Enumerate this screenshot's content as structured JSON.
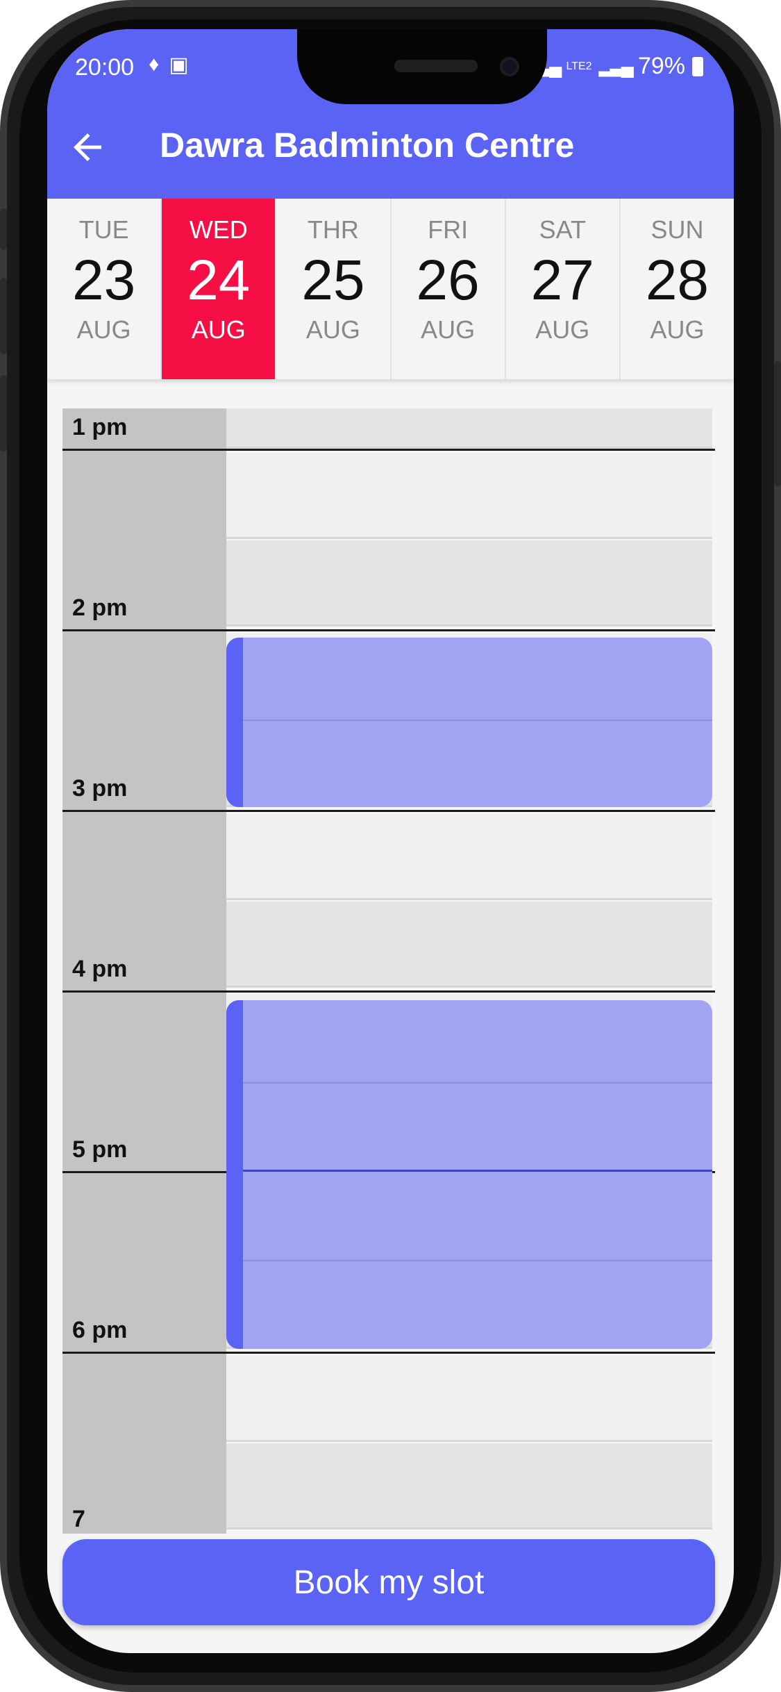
{
  "status_bar": {
    "time": "20:00",
    "battery": "79%",
    "network": "LTE2"
  },
  "header": {
    "title": "Dawra Badminton Centre"
  },
  "days": [
    {
      "name": "TUE",
      "num": "23",
      "month": "AUG",
      "selected": false
    },
    {
      "name": "WED",
      "num": "24",
      "month": "AUG",
      "selected": true
    },
    {
      "name": "THR",
      "num": "25",
      "month": "AUG",
      "selected": false
    },
    {
      "name": "FRI",
      "num": "26",
      "month": "AUG",
      "selected": false
    },
    {
      "name": "SAT",
      "num": "27",
      "month": "AUG",
      "selected": false
    },
    {
      "name": "SUN",
      "num": "28",
      "month": "AUG",
      "selected": false
    }
  ],
  "schedule": {
    "hours": [
      "1 pm",
      "2 pm",
      "3 pm",
      "4 pm",
      "5 pm",
      "6 pm",
      "7"
    ],
    "bookings": [
      {
        "start": "2:30 pm",
        "end": "3:30 pm"
      },
      {
        "start": "4:30 pm",
        "end": "6:30 pm"
      }
    ]
  },
  "footer": {
    "book_label": "Book my slot"
  },
  "colors": {
    "primary": "#5b63f5",
    "selected_day": "#f50f44",
    "booking": "#a0a4f2"
  }
}
